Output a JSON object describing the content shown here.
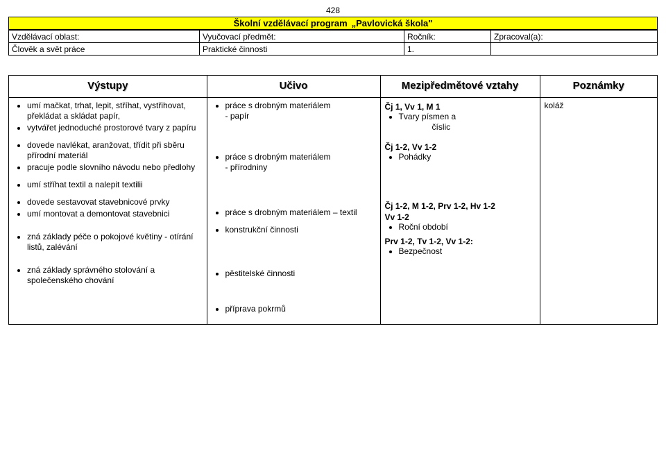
{
  "page_number": "428",
  "program_title_prefix": "Školní vzdělávací program",
  "program_title_name": "„Pavlovická škola\"",
  "header": {
    "row1": {
      "c1": "Vzdělávací oblast:",
      "c2": "Vyučovací předmět:",
      "c3": "Ročník:",
      "c4": "Zpracoval(a):"
    },
    "row2": {
      "c1": "Člověk a svět práce",
      "c2": "Praktické činnosti",
      "c3": "1.",
      "c4": ""
    }
  },
  "columns": {
    "outputs": "Výstupy",
    "curriculum": "Učivo",
    "relations": "Mezipředmětové vztahy",
    "notes": "Poznámky"
  },
  "outputs": {
    "b1": "umí mačkat, trhat, lepit, stříhat, vystřihovat, překládat a skládat papír,",
    "b2": "vytvářet jednoduché prostorové tvary z papíru",
    "b3": "dovede navlékat, aranžovat, třídit při sběru přírodní materiál",
    "b4": "pracuje podle slovního návodu nebo předlohy",
    "b5": "umí stříhat textil a nalepit textilii",
    "b6": "dovede sestavovat stavebnicové prvky",
    "b7": "umí montovat a demontovat stavebnici",
    "b8": "zná základy péče o pokojové květiny - otírání listů, zalévání",
    "b9": "zná základy správného stolování a společenského chování"
  },
  "curriculum": {
    "c1a": "práce s  drobným materiálem",
    "c1b": "- papír",
    "c2a": "práce s  drobným materiálem",
    "c2b": "- přírodniny",
    "c3": "práce s drobným materiálem – textil",
    "c4": "konstrukční činnosti",
    "c5": "pěstitelské činnosti",
    "c6": "příprava pokrmů"
  },
  "relations": {
    "r1": "Čj 1, Vv 1, M 1",
    "r1b": "Tvary písmen a",
    "r1c": "číslic",
    "r2": "Čj  1-2, Vv 1-2",
    "r2b": "Pohádky",
    "r3a": "Čj 1-2, M 1-2, Prv 1-2, Hv 1-2",
    "r3b": "Vv 1-2",
    "r3c": "Roční období",
    "r4": "Prv 1-2, Tv 1-2, Vv 1-2:",
    "r4b": "Bezpečnost"
  },
  "notes": {
    "n1": "koláž"
  }
}
